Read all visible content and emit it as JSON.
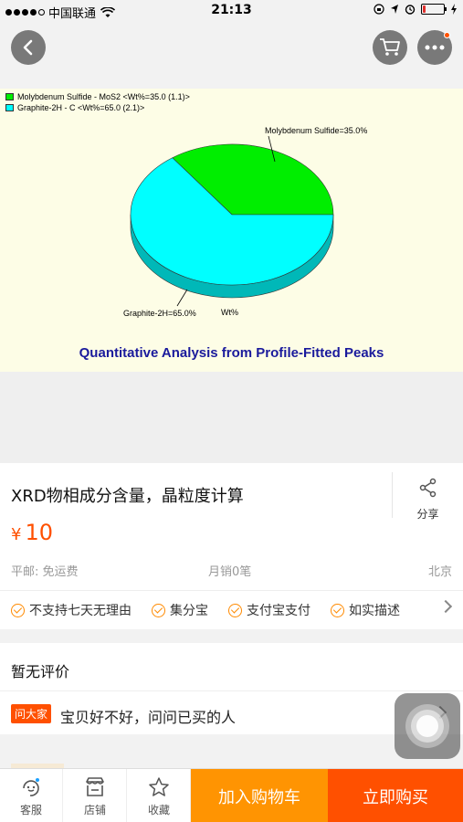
{
  "status_bar": {
    "carrier": "中国联通",
    "time": "21:13",
    "battery_level": 0.15
  },
  "top_buttons": [
    "back-icon",
    "cart-icon",
    "more-icon"
  ],
  "product_image": {
    "chart_data": {
      "type": "pie",
      "legend": [
        "Molybdenum Sulfide - MoS2 <Wt%=35.0 (1.1)>",
        "Graphite-2H - C <Wt%=65.0 (2.1)>"
      ],
      "slices": [
        {
          "label": "Molybdenum Sulfide=35.0%",
          "value": 35.0,
          "color": "#00ee00"
        },
        {
          "label": "Graphite-2H=65.0%",
          "value": 65.0,
          "color": "#00ffff"
        }
      ],
      "center_label": "Wt%",
      "title": "Quantitative Analysis from Profile-Fitted Peaks"
    }
  },
  "product": {
    "title": "XRD物相成分含量，晶粒度计算",
    "share_label": "分享",
    "price_symbol": "¥",
    "price": "10",
    "shipping": "平邮: 免运费",
    "monthly_sales": "月销0笔",
    "location": "北京",
    "services": [
      "不支持七天无理由",
      "集分宝",
      "支付宝支付",
      "如实描述"
    ]
  },
  "reviews": {
    "title": "暂无评价",
    "ask_tag": "问大家",
    "ask_text": "宝贝好不好，问问已买的人"
  },
  "bottom_bar": {
    "items": [
      {
        "label": "客服",
        "icon": "service-icon"
      },
      {
        "label": "店铺",
        "icon": "shop-icon"
      },
      {
        "label": "收藏",
        "icon": "star-icon"
      }
    ],
    "add_to_cart": "加入购物车",
    "buy_now": "立即购买"
  },
  "colors": {
    "accent_orange": "#ff5000",
    "cart_orange": "#ff9402"
  }
}
